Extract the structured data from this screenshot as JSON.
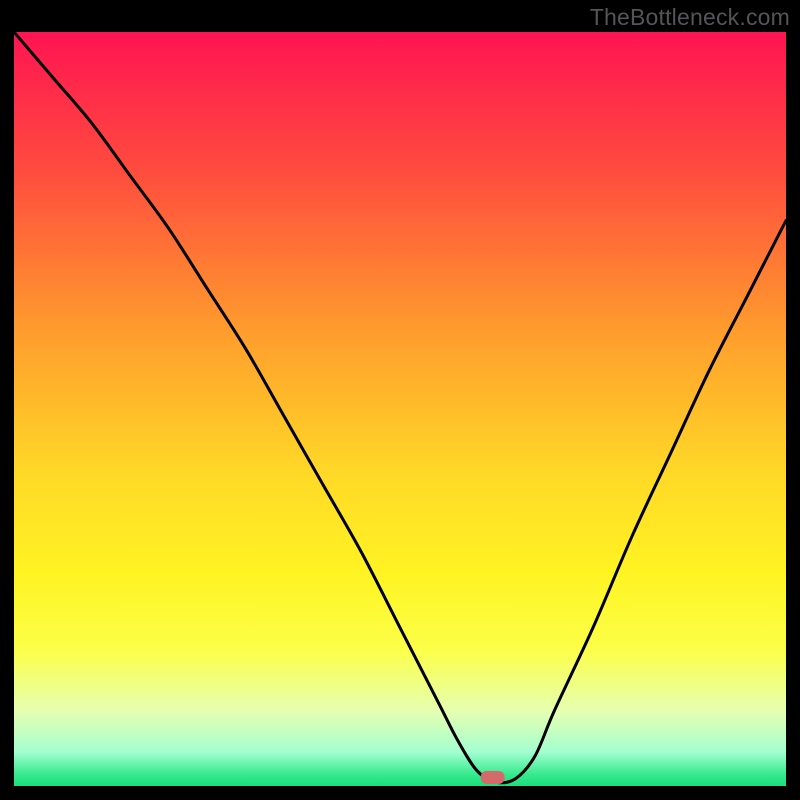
{
  "watermark": "TheBottleneck.com",
  "chart_data": {
    "type": "line",
    "title": "",
    "xlabel": "",
    "ylabel": "",
    "xlim": [
      0,
      100
    ],
    "ylim": [
      0,
      100
    ],
    "series": [
      {
        "name": "curve",
        "x": [
          0,
          5,
          10,
          15,
          20,
          25,
          30,
          35,
          40,
          45,
          50,
          55,
          57.5,
          60,
          62.5,
          65,
          67.5,
          70,
          75,
          80,
          85,
          90,
          95,
          100
        ],
        "values": [
          100,
          94,
          88,
          81,
          74,
          66,
          58,
          49,
          40,
          31,
          21,
          11,
          6,
          2,
          0.5,
          1,
          4,
          10,
          21,
          33,
          44,
          55,
          65,
          75
        ]
      }
    ],
    "marker": {
      "x": 62,
      "y": 1.2,
      "color": "#d46a6a"
    },
    "background_gradient": {
      "stops": [
        {
          "offset": 0.0,
          "color": "#ff1452"
        },
        {
          "offset": 0.18,
          "color": "#ff4a3f"
        },
        {
          "offset": 0.4,
          "color": "#ff9d2d"
        },
        {
          "offset": 0.58,
          "color": "#ffd727"
        },
        {
          "offset": 0.72,
          "color": "#fff423"
        },
        {
          "offset": 0.82,
          "color": "#fcff49"
        },
        {
          "offset": 0.9,
          "color": "#e6ffb0"
        },
        {
          "offset": 0.955,
          "color": "#a3ffd0"
        },
        {
          "offset": 0.985,
          "color": "#35e98d"
        },
        {
          "offset": 1.0,
          "color": "#18e07c"
        }
      ]
    }
  }
}
